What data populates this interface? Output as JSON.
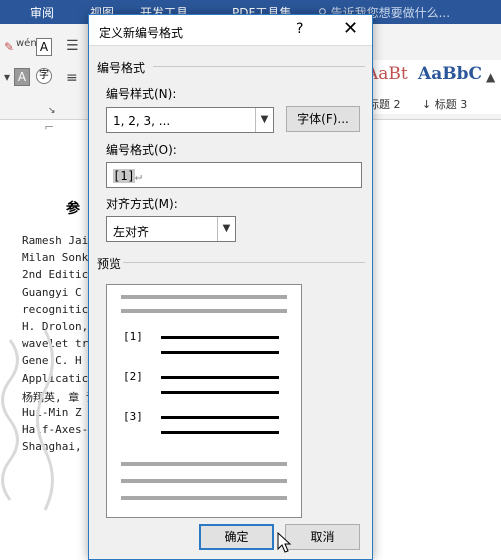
{
  "ribbon": {
    "tabs": [
      "审阅",
      "视图",
      "开发工具",
      "PDF工具集"
    ],
    "tell_me": "告诉我您想要做什么...",
    "styles": [
      {
        "sample": "AaBbC",
        "label": "标题 2"
      },
      {
        "sample": "AaBbC",
        "label": "标题 3"
      }
    ]
  },
  "document": {
    "heading": "参",
    "lines": [
      "Ramesh Jai                               Vision[M]. McGraw-Hi",
      "Milan Sonk                               ng, Analysis, and Mac",
      "2nd Editic",
      "Guangyi  C                                er-wavelet  descripto",
      "recognitic                               1088",
      "H. Drolon,                               nalysis and classific",
      "wavelet tr                              2000, 21:473~482",
      "Gene C. H                               criptor of Planar Cur",
      "Applicatic                              ng. 1996, 5(1):56-7",
      "杨翔英, 章                               计算机学报. 1999,22",
      "Hui-Min  Z                               oint  Of  Closed  Cont",
      "Half-Axes-                              on Machine Learning",
      "Shanghai,"
    ],
    "page_marker": "10"
  },
  "dialog": {
    "title": "定义新编号格式",
    "help": "?",
    "close": "✕",
    "group_number_format": "编号格式",
    "label_number_style": "编号样式(N):",
    "number_style_value": "1, 2, 3, ...",
    "font_button": "字体(F)...",
    "label_number_format": "编号格式(O):",
    "number_format_value": "[1]",
    "number_format_mark": "↵",
    "label_alignment": "对齐方式(M):",
    "alignment_value": "左对齐",
    "group_preview": "预览",
    "preview_numbers": [
      "[1]",
      "[2]",
      "[3]"
    ],
    "ok_button": "确定",
    "cancel_button": "取消"
  },
  "colors": {
    "title_bar": "#2b579a",
    "dialog_border": "#2b79c2",
    "style_sample": "#2b579a",
    "style_sample_red": "#c0504d"
  }
}
